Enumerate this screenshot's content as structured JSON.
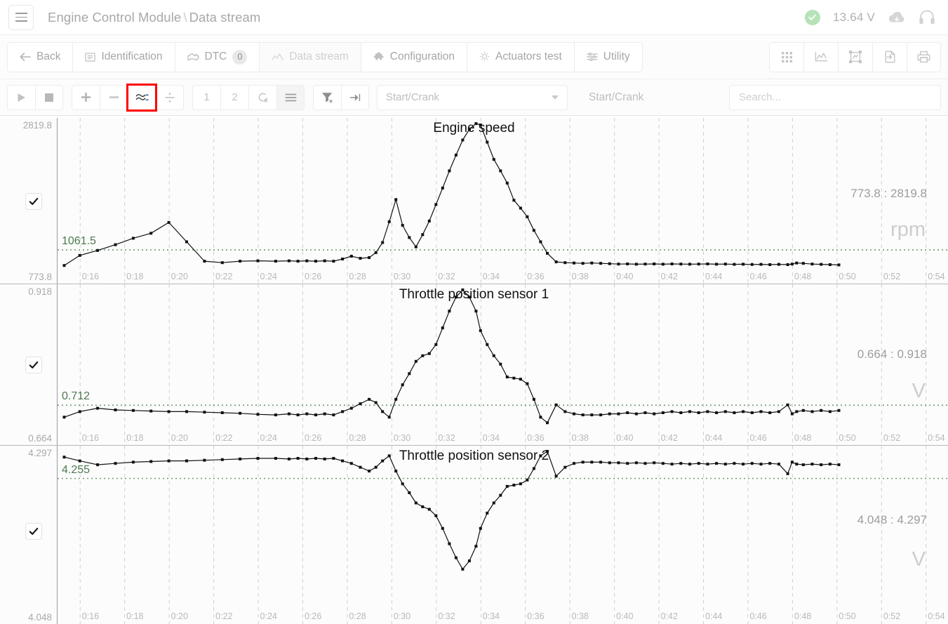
{
  "header": {
    "breadcrumb_module": "Engine Control Module",
    "breadcrumb_sep": "\\",
    "breadcrumb_page": "Data stream",
    "voltage": "13.64 V",
    "status_icon": "check-circle-icon",
    "cloud_icon": "cloud-download-icon",
    "headset_icon": "headset-icon",
    "menu_icon": "hamburger-menu-icon"
  },
  "tabs": [
    {
      "label": "Back",
      "icon": "arrow-left-icon",
      "name": "tab-back",
      "badge": null,
      "disabled": false
    },
    {
      "label": "Identification",
      "icon": "document-icon",
      "name": "tab-identification",
      "badge": null,
      "disabled": false
    },
    {
      "label": "DTC",
      "icon": "engine-icon",
      "name": "tab-dtc",
      "badge": "0",
      "disabled": false
    },
    {
      "label": "Data stream",
      "icon": "chart-line-icon",
      "name": "tab-data-stream",
      "badge": null,
      "disabled": true
    },
    {
      "label": "Configuration",
      "icon": "puzzle-icon",
      "name": "tab-configuration",
      "badge": null,
      "disabled": false
    },
    {
      "label": "Actuators test",
      "icon": "bulb-icon",
      "name": "tab-actuators-test",
      "badge": null,
      "disabled": false
    },
    {
      "label": "Utility",
      "icon": "sliders-icon",
      "name": "tab-utility",
      "badge": null,
      "disabled": false
    }
  ],
  "tab_actions": [
    {
      "icon": "grid-view-icon",
      "name": "view-grid-button"
    },
    {
      "icon": "graph-view-icon",
      "name": "view-graph-button"
    },
    {
      "icon": "fit-frame-icon",
      "name": "fit-frame-button"
    },
    {
      "icon": "export-icon",
      "name": "export-button"
    },
    {
      "icon": "print-icon",
      "name": "print-button"
    }
  ],
  "toolbar": {
    "play": "play-icon",
    "stop": "stop-icon",
    "plus": "plus-icon",
    "minus": "minus-icon",
    "wave": "wave-overlay-icon",
    "divide": "divide-icon",
    "one": "1",
    "two": "2",
    "clear": "clear-cursor-icon",
    "list": "list-icon",
    "filter_clear": "filter-clear-icon",
    "goto_end": "goto-end-icon",
    "trigger_value": "Start/Crank",
    "trigger_label": "Start/Crank",
    "search_placeholder": "Search..."
  },
  "chart_data": [
    {
      "type": "line",
      "title": "Engine speed",
      "ylabel": "rpm",
      "unit": "rpm",
      "range_label": "773.8 : 2819.8",
      "ylim": [
        773.8,
        2819.8
      ],
      "ymin_label": "773.8",
      "ymax_label": "2819.8",
      "reference_value": 1061.5,
      "reference_label": "1061.5",
      "checked": true,
      "xlabel": "",
      "x_ticks": [
        "0:16",
        "0:18",
        "0:20",
        "0:22",
        "0:24",
        "0:26",
        "0:28",
        "0:30",
        "0:32",
        "0:34",
        "0:36",
        "0:38",
        "0:40",
        "0:42",
        "0:44",
        "0:46",
        "0:48",
        "0:50",
        "0:52",
        "0:54"
      ],
      "xlim": [
        15.0,
        55.0
      ],
      "grid": true,
      "x": [
        15.3,
        16.0,
        16.8,
        17.6,
        18.4,
        19.2,
        20.0,
        20.8,
        21.6,
        22.4,
        23.2,
        24.0,
        24.8,
        25.4,
        25.8,
        26.2,
        26.6,
        27.0,
        27.4,
        27.8,
        28.2,
        28.6,
        29.0,
        29.3,
        29.6,
        29.9,
        30.2,
        30.5,
        30.8,
        31.1,
        31.4,
        31.7,
        32.0,
        32.3,
        32.6,
        32.9,
        33.2,
        33.5,
        33.8,
        34.0,
        34.3,
        34.6,
        34.9,
        35.2,
        35.5,
        35.8,
        36.1,
        36.4,
        36.7,
        37.0,
        37.4,
        37.8,
        38.2,
        38.6,
        39.0,
        39.4,
        39.8,
        40.2,
        40.6,
        41.0,
        41.4,
        41.8,
        42.2,
        42.6,
        43.0,
        43.4,
        43.8,
        44.2,
        44.6,
        45.0,
        45.4,
        45.8,
        46.2,
        46.6,
        47.0,
        47.4,
        47.8,
        48.0,
        48.2,
        48.5,
        48.9,
        49.3,
        49.7,
        50.1
      ],
      "y": [
        840,
        980,
        1050,
        1130,
        1220,
        1290,
        1440,
        1170,
        900,
        880,
        900,
        905,
        900,
        905,
        900,
        905,
        900,
        905,
        900,
        930,
        970,
        940,
        950,
        1020,
        1160,
        1450,
        1760,
        1400,
        1230,
        1100,
        1270,
        1460,
        1690,
        1920,
        2160,
        2380,
        2590,
        2740,
        2819,
        2800,
        2560,
        2320,
        2160,
        1990,
        1750,
        1640,
        1520,
        1330,
        1170,
        1010,
        890,
        880,
        875,
        870,
        875,
        870,
        865,
        860,
        862,
        858,
        860,
        862,
        858,
        862,
        860,
        858,
        860,
        862,
        858,
        860,
        856,
        858,
        854,
        856,
        852,
        856,
        852,
        860,
        875,
        870,
        860,
        856,
        852,
        848
      ],
      "legend_position": "none"
    },
    {
      "type": "line",
      "title": "Throttle position sensor 1",
      "ylabel": "V",
      "unit": "V",
      "range_label": "0.664 : 0.918",
      "ylim": [
        0.664,
        0.918
      ],
      "ymin_label": "0.664",
      "ymax_label": "0.918",
      "reference_value": 0.712,
      "reference_label": "0.712",
      "checked": true,
      "xlabel": "",
      "x_ticks": [
        "0:16",
        "0:18",
        "0:20",
        "0:22",
        "0:24",
        "0:26",
        "0:28",
        "0:30",
        "0:32",
        "0:34",
        "0:36",
        "0:38",
        "0:40",
        "0:42",
        "0:44",
        "0:46",
        "0:48",
        "0:50",
        "0:52",
        "0:54"
      ],
      "xlim": [
        15.0,
        55.0
      ],
      "grid": true,
      "x": [
        15.3,
        16.0,
        16.8,
        17.6,
        18.4,
        19.2,
        20.0,
        20.8,
        21.6,
        22.4,
        23.2,
        24.0,
        24.8,
        25.4,
        25.8,
        26.2,
        26.6,
        27.0,
        27.4,
        27.8,
        28.2,
        28.6,
        29.0,
        29.3,
        29.6,
        29.9,
        30.2,
        30.5,
        30.8,
        31.1,
        31.4,
        31.7,
        32.0,
        32.3,
        32.6,
        32.9,
        33.2,
        33.5,
        33.8,
        34.0,
        34.3,
        34.6,
        34.9,
        35.2,
        35.5,
        35.8,
        36.1,
        36.4,
        36.7,
        37.0,
        37.4,
        37.8,
        38.2,
        38.6,
        39.0,
        39.4,
        39.8,
        40.2,
        40.6,
        41.0,
        41.4,
        41.8,
        42.2,
        42.6,
        43.0,
        43.4,
        43.8,
        44.2,
        44.6,
        45.0,
        45.4,
        45.8,
        46.2,
        46.6,
        47.0,
        47.4,
        47.8,
        48.0,
        48.2,
        48.5,
        48.9,
        49.3,
        49.7,
        50.1
      ],
      "y": [
        0.69,
        0.7,
        0.706,
        0.703,
        0.702,
        0.701,
        0.7,
        0.7,
        0.699,
        0.698,
        0.697,
        0.695,
        0.694,
        0.696,
        0.694,
        0.696,
        0.694,
        0.696,
        0.694,
        0.7,
        0.706,
        0.714,
        0.722,
        0.716,
        0.7,
        0.69,
        0.722,
        0.748,
        0.768,
        0.79,
        0.8,
        0.804,
        0.82,
        0.85,
        0.88,
        0.905,
        0.918,
        0.905,
        0.88,
        0.845,
        0.82,
        0.8,
        0.785,
        0.762,
        0.76,
        0.758,
        0.75,
        0.722,
        0.69,
        0.68,
        0.712,
        0.7,
        0.696,
        0.694,
        0.694,
        0.694,
        0.696,
        0.696,
        0.698,
        0.696,
        0.698,
        0.696,
        0.698,
        0.7,
        0.698,
        0.7,
        0.698,
        0.7,
        0.698,
        0.7,
        0.698,
        0.7,
        0.698,
        0.7,
        0.698,
        0.7,
        0.712,
        0.696,
        0.7,
        0.702,
        0.7,
        0.702,
        0.7,
        0.702
      ],
      "legend_position": "none"
    },
    {
      "type": "line",
      "title": "Throttle position sensor 2",
      "ylabel": "V",
      "unit": "V",
      "range_label": "4.048 : 4.297",
      "ylim": [
        4.048,
        4.297
      ],
      "ymin_label": "4.048",
      "ymax_label": "4.297",
      "reference_value": 4.255,
      "reference_label": "4.255",
      "checked": true,
      "xlabel": "",
      "x_ticks": [
        "0:16",
        "0:18",
        "0:20",
        "0:22",
        "0:24",
        "0:26",
        "0:28",
        "0:30",
        "0:32",
        "0:34",
        "0:36",
        "0:38",
        "0:40",
        "0:42",
        "0:44",
        "0:46",
        "0:48",
        "0:50",
        "0:52",
        "0:54"
      ],
      "xlim": [
        15.0,
        55.0
      ],
      "grid": true,
      "x": [
        15.3,
        16.0,
        16.8,
        17.6,
        18.4,
        19.2,
        20.0,
        20.8,
        21.6,
        22.4,
        23.2,
        24.0,
        24.8,
        25.4,
        25.8,
        26.2,
        26.6,
        27.0,
        27.4,
        27.8,
        28.2,
        28.6,
        29.0,
        29.3,
        29.6,
        29.9,
        30.2,
        30.5,
        30.8,
        31.1,
        31.4,
        31.7,
        32.0,
        32.3,
        32.6,
        32.9,
        33.2,
        33.5,
        33.8,
        34.0,
        34.3,
        34.6,
        34.9,
        35.2,
        35.5,
        35.8,
        36.1,
        36.4,
        36.7,
        37.0,
        37.4,
        37.8,
        38.2,
        38.6,
        39.0,
        39.4,
        39.8,
        40.2,
        40.6,
        41.0,
        41.4,
        41.8,
        42.2,
        42.6,
        43.0,
        43.4,
        43.8,
        44.2,
        44.6,
        45.0,
        45.4,
        45.8,
        46.2,
        46.6,
        47.0,
        47.4,
        47.8,
        48.0,
        48.2,
        48.5,
        48.9,
        49.3,
        49.7,
        50.1
      ],
      "y": [
        4.288,
        4.282,
        4.276,
        4.278,
        4.28,
        4.281,
        4.282,
        4.282,
        4.283,
        4.284,
        4.285,
        4.286,
        4.286,
        4.285,
        4.286,
        4.285,
        4.286,
        4.285,
        4.286,
        4.282,
        4.278,
        4.272,
        4.266,
        4.272,
        4.282,
        4.29,
        4.266,
        4.246,
        4.232,
        4.216,
        4.21,
        4.206,
        4.196,
        4.176,
        4.152,
        4.13,
        4.112,
        4.125,
        4.148,
        4.176,
        4.2,
        4.216,
        4.228,
        4.242,
        4.244,
        4.246,
        4.252,
        4.27,
        4.29,
        4.297,
        4.258,
        4.272,
        4.278,
        4.28,
        4.28,
        4.28,
        4.279,
        4.279,
        4.278,
        4.279,
        4.278,
        4.279,
        4.278,
        4.277,
        4.278,
        4.277,
        4.278,
        4.277,
        4.278,
        4.277,
        4.278,
        4.277,
        4.278,
        4.277,
        4.278,
        4.277,
        4.262,
        4.28,
        4.277,
        4.276,
        4.277,
        4.276,
        4.277,
        4.276
      ],
      "legend_position": "none"
    }
  ],
  "colors": {
    "accent_green": "#4c7a4e",
    "reference_line": "#6f9c70",
    "trace": "#111111",
    "grid": "#cfcfcf",
    "highlight": "#ff0000",
    "status_ok": "#b6e2b8"
  }
}
